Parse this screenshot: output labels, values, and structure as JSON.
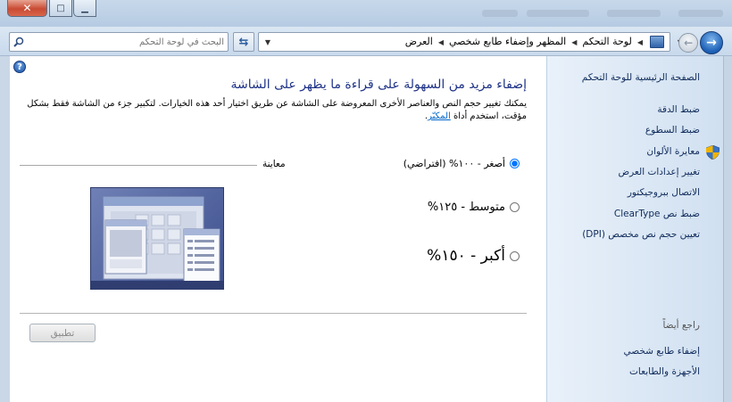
{
  "window": {
    "close_glyph": "✕",
    "maximize_glyph": "□",
    "minimize_glyph": "▁"
  },
  "address": {
    "search_placeholder": "البحث في لوحة التحكم",
    "breadcrumb": [
      "لوحة التحكم",
      "المظهر وإضفاء طابع شخصي",
      "العرض"
    ],
    "refresh_glyph": "⇆",
    "dropdown_glyph": "▼",
    "forward_glyph": "→",
    "back_glyph": "→"
  },
  "content": {
    "help_glyph": "?",
    "title": "إضفاء مزيد من السهولة على قراءة ما يظهر على الشاشة",
    "description": "يمكنك تغيير حجم النص والعناصر الأخرى المعروضة على الشاشة عن طريق اختيار أحد هذه الخيارات. لتكبير جزء من الشاشة فقط بشكل مؤقت، استخدم أداة",
    "description_link": "المكبّر",
    "preview_label": "معاينة",
    "options": [
      {
        "label": "أصغر - ١٠٠% (افتراضي)",
        "selected": true
      },
      {
        "label": "متوسط - ١٢٥%",
        "selected": false
      },
      {
        "label": "أكبر - ١٥٠%",
        "selected": false
      }
    ],
    "apply_label": "تطبيق"
  },
  "pane": {
    "home": "الصفحة الرئيسية للوحة التحكم",
    "links": [
      "ضبط الدقة",
      "ضبط السطوع",
      "معايرة الألوان",
      "تغيير إعدادات العرض",
      "الاتصال ببروجيكتور",
      "ضبط نص ClearType",
      "تعيين حجم نص مخصص (DPI)"
    ],
    "see_also": "راجع أيضاً",
    "see_also_links": [
      "إضفاء طابع شخصي",
      "الأجهزة والطابعات"
    ]
  },
  "colors": {
    "title_blue": "#1e3287",
    "link_blue": "#0066cc",
    "pane_text": "#102c5c"
  }
}
